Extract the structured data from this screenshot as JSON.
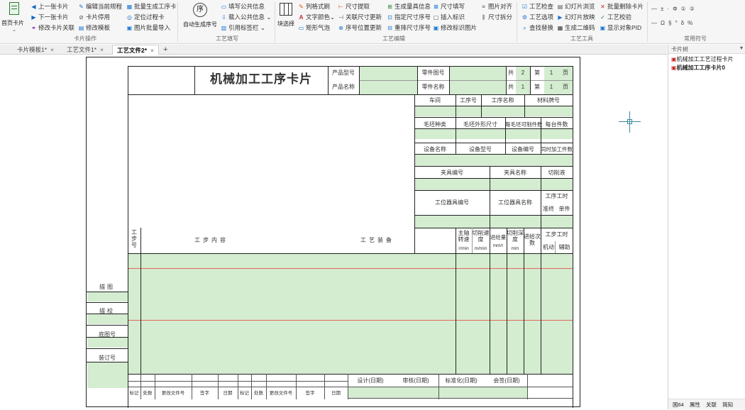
{
  "ribbon": {
    "big_first": "首页卡片",
    "card_ops": {
      "up": "上一张卡片",
      "down": "下一张卡片",
      "modify_link": "修改卡片关联",
      "edit_rule": "编辑当前规程",
      "card_disable": "卡片停用",
      "modify_template": "修改模板",
      "batch_gen": "批量生成工序卡",
      "locate": "定位过程卡",
      "img_import": "图片批量导入",
      "label": "卡片操作"
    },
    "craft_fill": {
      "auto_seq": "自动生成序号",
      "seq_glyph": "序",
      "fill_public": "填写公共信息",
      "load_public": "载入公共信息",
      "ref_tag": "引用标签栏",
      "label": "工艺填写"
    },
    "craft_edit": {
      "grid_select": "块选择",
      "list_trial": "列格式刷",
      "text_color": "文字颜色",
      "rect_air": "矩形气泡",
      "dim_extract": "尺寸提取",
      "link_dim": "关联尺寸更新",
      "seq_pos": "序号位置更新",
      "gen_gauge": "生成量具信息",
      "spec_dim_seq": "指定尺寸序号",
      "arrange_dim": "重排尺寸序号",
      "dim_fill": "尺寸填写",
      "insert_sign": "插入标识",
      "modify_sign": "修改标识图片",
      "img_align": "图片对齐",
      "dim_split": "尺寸拆分",
      "label": "工艺编辑"
    },
    "craft_tools": {
      "check": "工艺检查",
      "slide_browse": "幻灯片浏览",
      "batch_delete": "批量删除卡片",
      "option": "工艺选项",
      "slide_play": "幻灯片放映",
      "verify": "工艺校验",
      "find_replace": "查找替换",
      "gen_qr": "生成二维码",
      "show_pid": "显示对象PID",
      "label": "工艺工具"
    },
    "symbols": {
      "row1": [
        "—",
        "±",
        "·",
        "Φ",
        "①",
        "②"
      ],
      "row2": [
        "—",
        "Ω",
        "§",
        "°",
        "δ",
        "%"
      ],
      "label": "常用符号"
    }
  },
  "tabs": [
    {
      "label": "卡片模板1*",
      "active": false
    },
    {
      "label": "工艺文件1*",
      "active": false
    },
    {
      "label": "工艺文件2*",
      "active": true
    }
  ],
  "right_panel": {
    "title": "卡片树",
    "tree": [
      "机械加工工艺过程卡片",
      "机械加工工序卡片0"
    ],
    "bottom_tabs": [
      "国64",
      "属性",
      "关联",
      "简知"
    ]
  },
  "card": {
    "title": "机械加工工序卡片",
    "product_model": "产品型号",
    "product_name": "产品名称",
    "part_no": "零件图号",
    "part_name": "零件名称",
    "total": "共",
    "page": "第",
    "page_unit": "页",
    "total_val": "2",
    "total_val2": "1",
    "page_val": "1",
    "page_val2": "1",
    "workshop": "车间",
    "proc_no": "工序号",
    "proc_name": "工序名称",
    "material": "材料牌号",
    "blank_type": "毛坯种类",
    "blank_size": "毛坯外形尺寸",
    "blank_parts": "每毛坯可制件数",
    "per_unit": "每台件数",
    "equip_name": "设备名称",
    "equip_model": "设备型号",
    "equip_no": "设备编号",
    "simul": "同时加工件数",
    "fixture_no": "夹具编号",
    "fixture_name": "夹具名称",
    "coolant": "切削液",
    "station_tool_no": "工位器具编号",
    "station_tool_name": "工位器具名称",
    "time_quota": "工序工时",
    "quasi": "准终",
    "unit_time": "单件",
    "step_no": "工步号",
    "step_content": "工步内容",
    "craft_equip": "工艺装备",
    "spindle": "主轴转速",
    "spindle_unit": "r/min",
    "cut_speed": "切削速度",
    "cut_speed_unit": "m/min",
    "feed": "进给量",
    "feed_unit": "mm/r",
    "depth": "切削深度",
    "depth_unit": "mm",
    "passes": "进给次数",
    "step_time": "工步工时",
    "mech": "机动",
    "aux": "辅助",
    "drawing": "描图",
    "tracing": "描校",
    "base_no": "底图号",
    "bind_no": "装订号",
    "design": "设计(日期)",
    "review": "审核(日期)",
    "standard": "标准化(日期)",
    "sign": "会签(日期)",
    "foot": [
      "标记",
      "处数",
      "更改文件号",
      "签字",
      "日期",
      "标记",
      "处数",
      "更改文件号",
      "签字",
      "日期"
    ]
  }
}
